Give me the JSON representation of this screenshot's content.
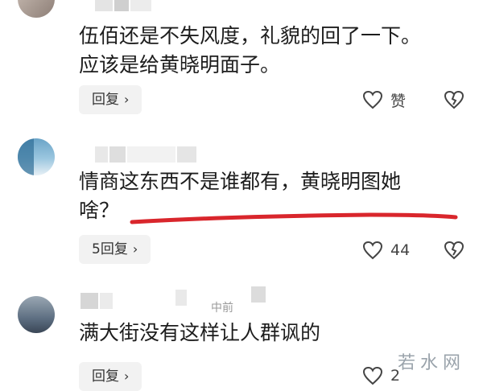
{
  "comments": [
    {
      "lines": [
        "伍佰还是不失风度，礼貌的回了一下。",
        "应该是给黄晓明面子。"
      ],
      "reply_label": "回复",
      "like_label": "赞"
    },
    {
      "lines": [
        "情商这东西不是谁都有，黄晓明图她",
        "啥？"
      ],
      "reply_label": "5回复",
      "like_count": "44"
    },
    {
      "lines": [
        "满大街没有这样让人群讽的"
      ],
      "reply_label": "回复",
      "like_count": "2"
    }
  ],
  "username_fragments": {
    "c3": "中前"
  },
  "watermark": "若水网",
  "colors": {
    "annotation_red": "#d9262c",
    "button_bg": "#f2f2f2"
  },
  "icons": {
    "like": "heart-outline-icon",
    "dislike": "broken-heart-icon",
    "chevron": "chevron-right-icon"
  }
}
